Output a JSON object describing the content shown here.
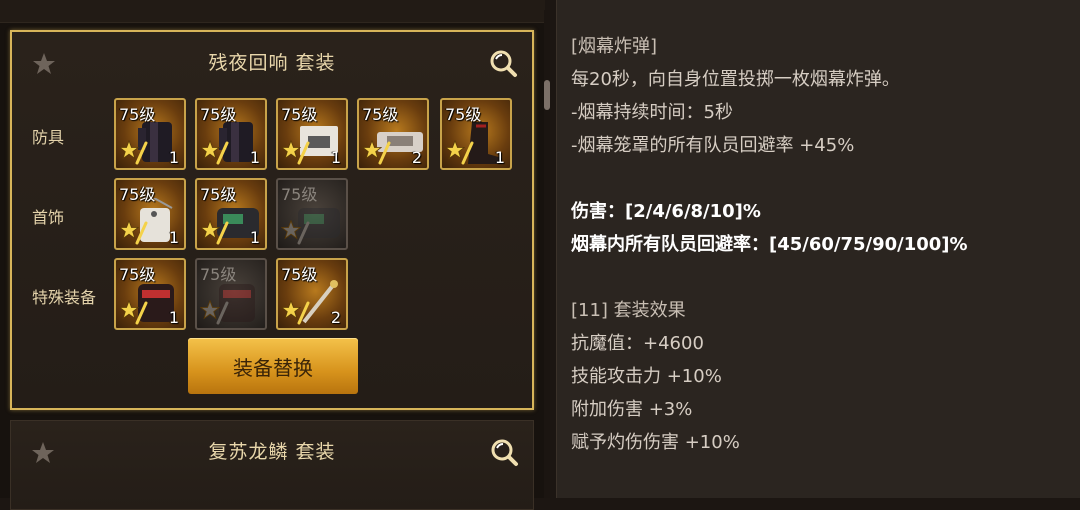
{
  "sets": [
    {
      "title": "残夜回响  套装",
      "rows": [
        {
          "label": "防具",
          "slots": [
            {
              "level": "75级",
              "count": "1",
              "dim": false,
              "art": "coat"
            },
            {
              "level": "75级",
              "count": "1",
              "dim": false,
              "art": "coat"
            },
            {
              "level": "75级",
              "count": "1",
              "dim": false,
              "art": "card"
            },
            {
              "level": "75级",
              "count": "2",
              "dim": false,
              "art": "belt"
            },
            {
              "level": "75级",
              "count": "1",
              "dim": false,
              "art": "boots"
            }
          ]
        },
        {
          "label": "首饰",
          "slots": [
            {
              "level": "75级",
              "count": "1",
              "dim": false,
              "art": "tag"
            },
            {
              "level": "75级",
              "count": "1",
              "dim": false,
              "art": "device"
            },
            {
              "level": "75级",
              "count": "",
              "dim": true,
              "art": "device"
            }
          ]
        },
        {
          "label": "特殊装备",
          "slots": [
            {
              "level": "75级",
              "count": "1",
              "dim": false,
              "art": "bracer"
            },
            {
              "level": "75级",
              "count": "",
              "dim": true,
              "art": "bracer"
            },
            {
              "level": "75级",
              "count": "2",
              "dim": false,
              "art": "needle"
            }
          ]
        }
      ],
      "button_label": "装备替换"
    },
    {
      "title": "复苏龙鳞  套装"
    }
  ],
  "description": {
    "lines": [
      {
        "text": "[烟幕炸弹]",
        "style": "muted"
      },
      {
        "text": "每20秒，向自身位置投掷一枚烟幕炸弹。",
        "style": "normal"
      },
      {
        "text": "-烟幕持续时间：5秒",
        "style": "normal"
      },
      {
        "text": "-烟幕笼罩的所有队员回避率 +45%",
        "style": "normal"
      },
      {
        "text": "",
        "style": "normal"
      },
      {
        "text": "伤害：[2/4/6/8/10]%",
        "style": "bold"
      },
      {
        "text": "烟幕内所有队员回避率：[45/60/75/90/100]%",
        "style": "bold"
      },
      {
        "text": "",
        "style": "normal"
      },
      {
        "text": "[11] 套装效果",
        "style": "muted"
      },
      {
        "text": "抗魔值：+4600",
        "style": "normal"
      },
      {
        "text": "技能攻击力 +10%",
        "style": "normal"
      },
      {
        "text": "附加伤害 +3%",
        "style": "normal"
      },
      {
        "text": "赋予灼伤伤害 +10%",
        "style": "normal"
      }
    ]
  },
  "colors": {
    "accent_gold": "#d7b55a",
    "button_gold": "#f4c24a",
    "panel_bg": "#2a221b"
  }
}
